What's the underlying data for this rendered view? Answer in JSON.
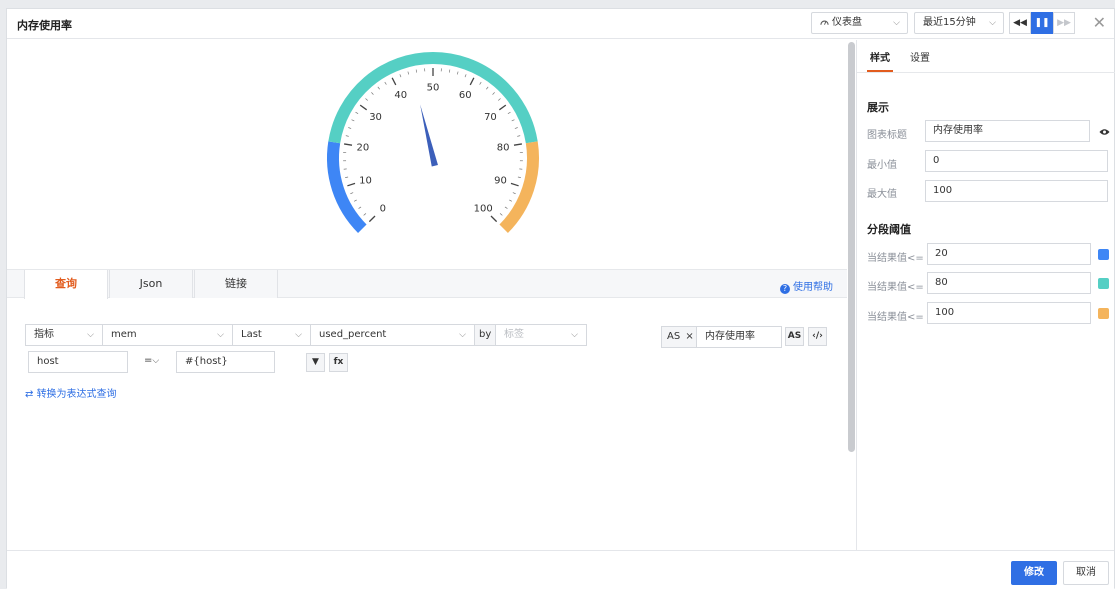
{
  "header": {
    "title": "内存使用率",
    "chart_type_label": "仪表盘",
    "time_range_label": "最近15分钟"
  },
  "gauge": {
    "min": 0,
    "max": 100,
    "value": 45,
    "tick_labels": [
      "0",
      "10",
      "20",
      "30",
      "40",
      "50",
      "60",
      "70",
      "80",
      "90",
      "100"
    ],
    "bands": [
      {
        "to": 20,
        "color": "#3e86f5"
      },
      {
        "to": 80,
        "color": "#55cfc4"
      },
      {
        "to": 100,
        "color": "#f4b45c"
      }
    ],
    "needle_color": "#3c5fba"
  },
  "query_tabs": [
    "查询",
    "Json",
    "链接"
  ],
  "help_label": "使用帮助",
  "query": {
    "type_select": "指标",
    "measurement_select": "mem",
    "func_select": "Last",
    "field_select": "used_percent",
    "by_label": "by",
    "tag_placeholder": "标签",
    "filter_key": "host",
    "filter_op": "=",
    "filter_value": "#{host}",
    "filter_btn": "▼",
    "fx_btn": "fx",
    "as_tag": "AS",
    "as_close": "×",
    "alias_value": "内存使用率",
    "as_btn": "AS",
    "code_btn": "‹/›",
    "convert_link": "转换为表达式查询"
  },
  "settings": {
    "tabs": [
      "样式",
      "设置"
    ],
    "display_section": "展示",
    "chart_title_label": "图表标题",
    "chart_title_value": "内存使用率",
    "min_label": "最小值",
    "min_value": "0",
    "max_label": "最大值",
    "max_value": "100",
    "threshold_section": "分段阈值",
    "thresholds": [
      {
        "label": "当结果值<=",
        "value": "20",
        "color": "#3e86f5"
      },
      {
        "label": "当结果值<=",
        "value": "80",
        "color": "#55cfc4"
      },
      {
        "label": "当结果值<=",
        "value": "100",
        "color": "#f4b45c"
      }
    ]
  },
  "footer": {
    "submit_label": "修改",
    "cancel_label": "取消"
  }
}
